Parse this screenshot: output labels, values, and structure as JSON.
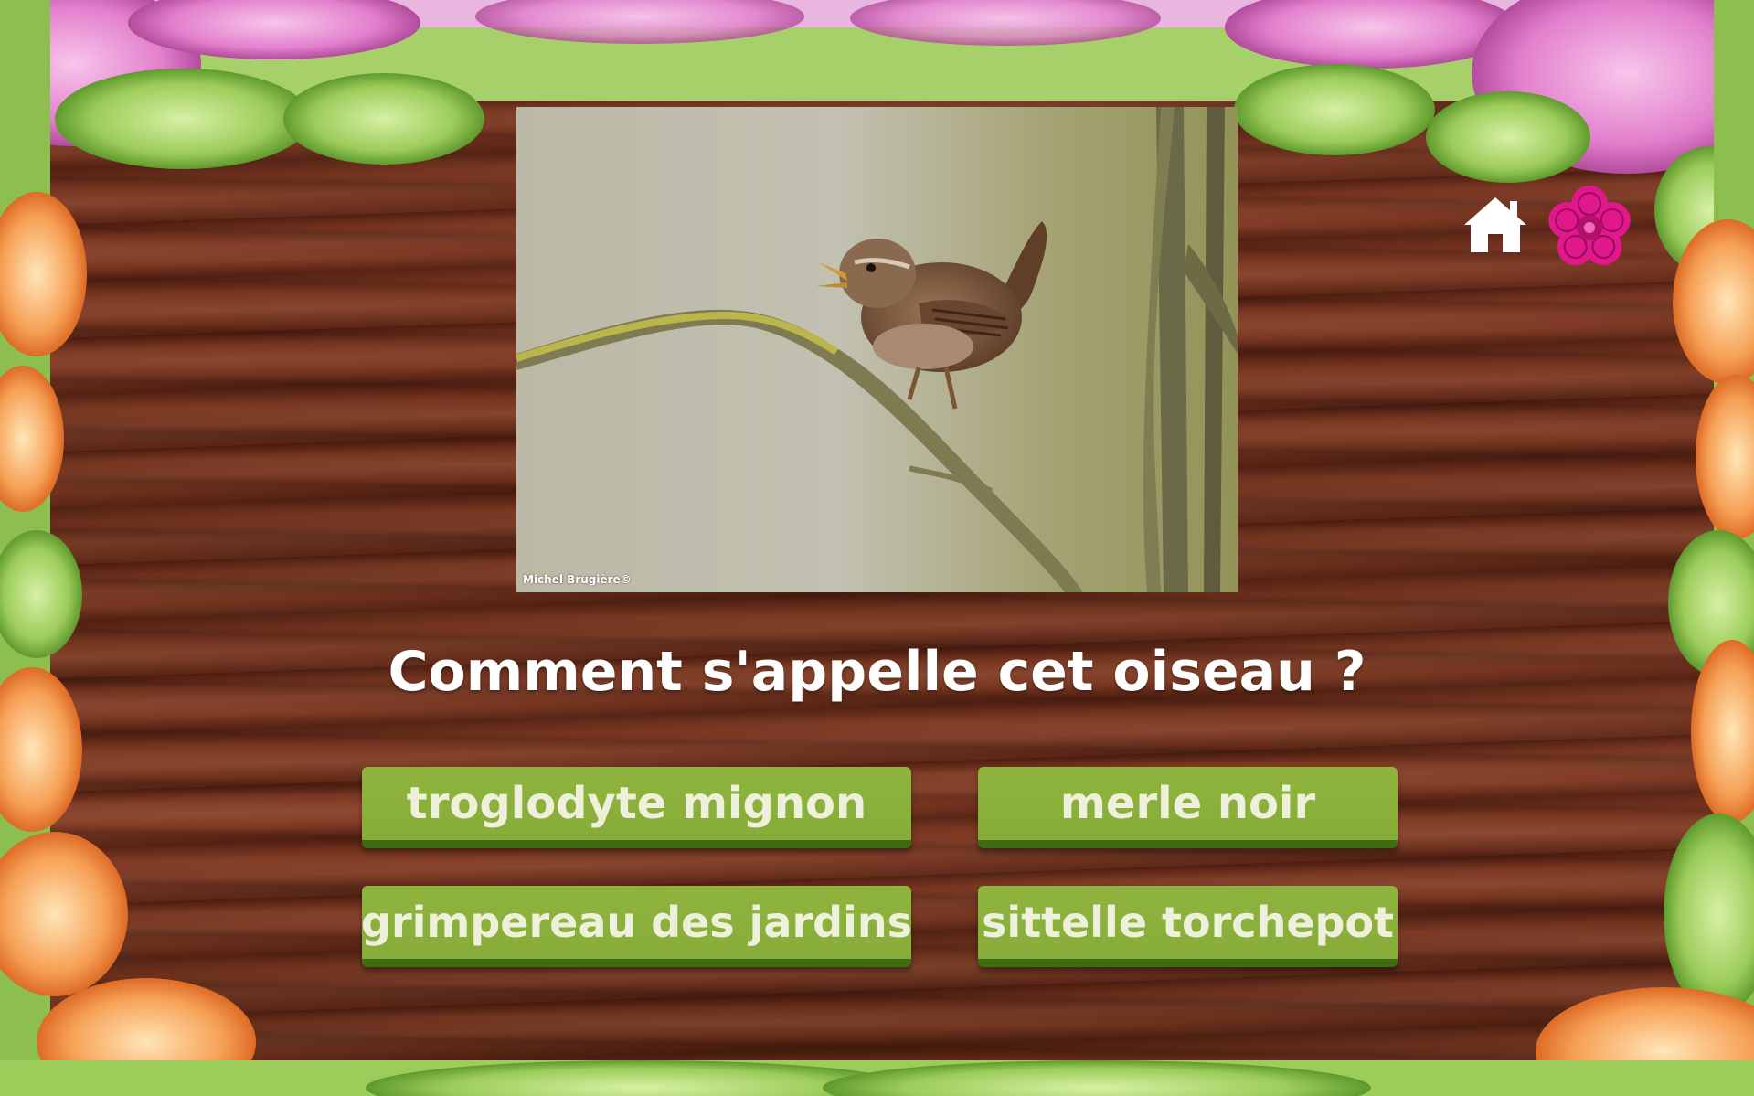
{
  "photo": {
    "credit": "Michel Brugière©"
  },
  "header_icons": {
    "home": "home-icon",
    "menu": "flower-icon"
  },
  "question": "Comment s'appelle cet oiseau ?",
  "answers": [
    {
      "label": "troglodyte mignon"
    },
    {
      "label": "merle noir"
    },
    {
      "label": "grimpereau des jardins"
    },
    {
      "label": "sittelle torchepot"
    }
  ],
  "colors": {
    "button": "#8fb43e",
    "button_shadow": "#3c6d13",
    "button_text": "#eef0dc",
    "flower_accent": "#e0188c",
    "wood": "#6b2f1b"
  }
}
